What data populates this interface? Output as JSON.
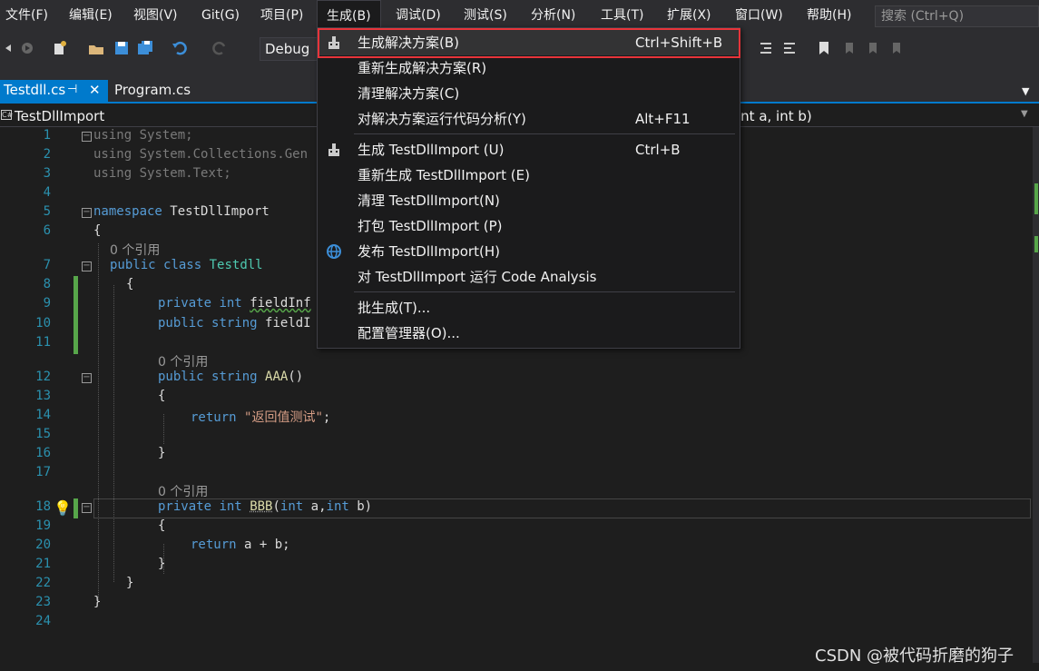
{
  "menubar": {
    "items": [
      "文件(F)",
      "编辑(E)",
      "视图(V)",
      "Git(G)",
      "项目(P)",
      "生成(B)",
      "调试(D)",
      "测试(S)",
      "分析(N)",
      "工具(T)",
      "扩展(X)",
      "窗口(W)",
      "帮助(H)"
    ],
    "search_placeholder": "搜索 (Ctrl+Q)"
  },
  "toolbar": {
    "config": "Debug"
  },
  "tabs": [
    {
      "label": "Testdll.cs",
      "active": true
    },
    {
      "label": "Program.cs",
      "active": false
    }
  ],
  "navbar": {
    "left": "TestDllImport",
    "right": "int a, int b)"
  },
  "editor": {
    "line_numbers": [
      "1",
      "2",
      "3",
      "4",
      "5",
      "6",
      "7",
      "8",
      "9",
      "10",
      "11",
      "12",
      "13",
      "14",
      "15",
      "16",
      "17",
      "18",
      "19",
      "20",
      "21",
      "22",
      "23",
      "24"
    ],
    "codelens": "0 个引用",
    "lines": {
      "l1a": "using",
      "l1b": " System;",
      "l2a": "using",
      "l2b": " System.Collections.Gen",
      "l3a": "using",
      "l3b": " System.Text;",
      "l5a": "namespace",
      "l5b": " TestDllImport",
      "l6": "{",
      "l7a": "public",
      "l7b": "class",
      "l7c": "Testdll",
      "l8": "{",
      "l9a": "private",
      "l9b": "int",
      "l9c": "fieldInf",
      "l10a": "public",
      "l10b": "string",
      "l10c": "fieldI",
      "l12a": "public",
      "l12b": "string",
      "l12c": "AAA",
      "l12d": "()",
      "l13": "{",
      "l14a": "return",
      "l14b": "\"返回值测试\"",
      "l14c": ";",
      "l16": "}",
      "l18a": "private",
      "l18b": "int",
      "l18c": "BBB",
      "l18d": "(",
      "l18e": "int",
      "l18f": " a,",
      "l18g": "int",
      "l18h": " b)",
      "l19": "{",
      "l20a": "return",
      "l20b": " a + b;",
      "l21": "}",
      "l22": "}",
      "l23": "}"
    }
  },
  "build_menu": {
    "items": [
      {
        "label": "生成解决方案(B)",
        "shortcut": "Ctrl+Shift+B",
        "icon": "build-icon"
      },
      {
        "label": "重新生成解决方案(R)",
        "shortcut": ""
      },
      {
        "label": "清理解决方案(C)",
        "shortcut": ""
      },
      {
        "label": "对解决方案运行代码分析(Y)",
        "shortcut": "Alt+F11"
      },
      {
        "label": "生成 TestDllImport (U)",
        "shortcut": "Ctrl+B",
        "icon": "build-icon"
      },
      {
        "label": "重新生成 TestDllImport (E)",
        "shortcut": ""
      },
      {
        "label": "清理 TestDllImport(N)",
        "shortcut": ""
      },
      {
        "label": "打包 TestDllImport (P)",
        "shortcut": ""
      },
      {
        "label": "发布 TestDllImport(H)",
        "shortcut": "",
        "icon": "globe-icon"
      },
      {
        "label": "对 TestDllImport 运行 Code Analysis",
        "shortcut": ""
      },
      {
        "label": "批生成(T)...",
        "shortcut": ""
      },
      {
        "label": "配置管理器(O)...",
        "shortcut": ""
      }
    ]
  },
  "colors": {
    "accent": "#007acc",
    "highlight_border": "#e8343a",
    "keyword": "#569cd6",
    "type": "#4ec9b0",
    "string": "#d69d85"
  },
  "watermark": "CSDN @被代码折磨的狗子"
}
